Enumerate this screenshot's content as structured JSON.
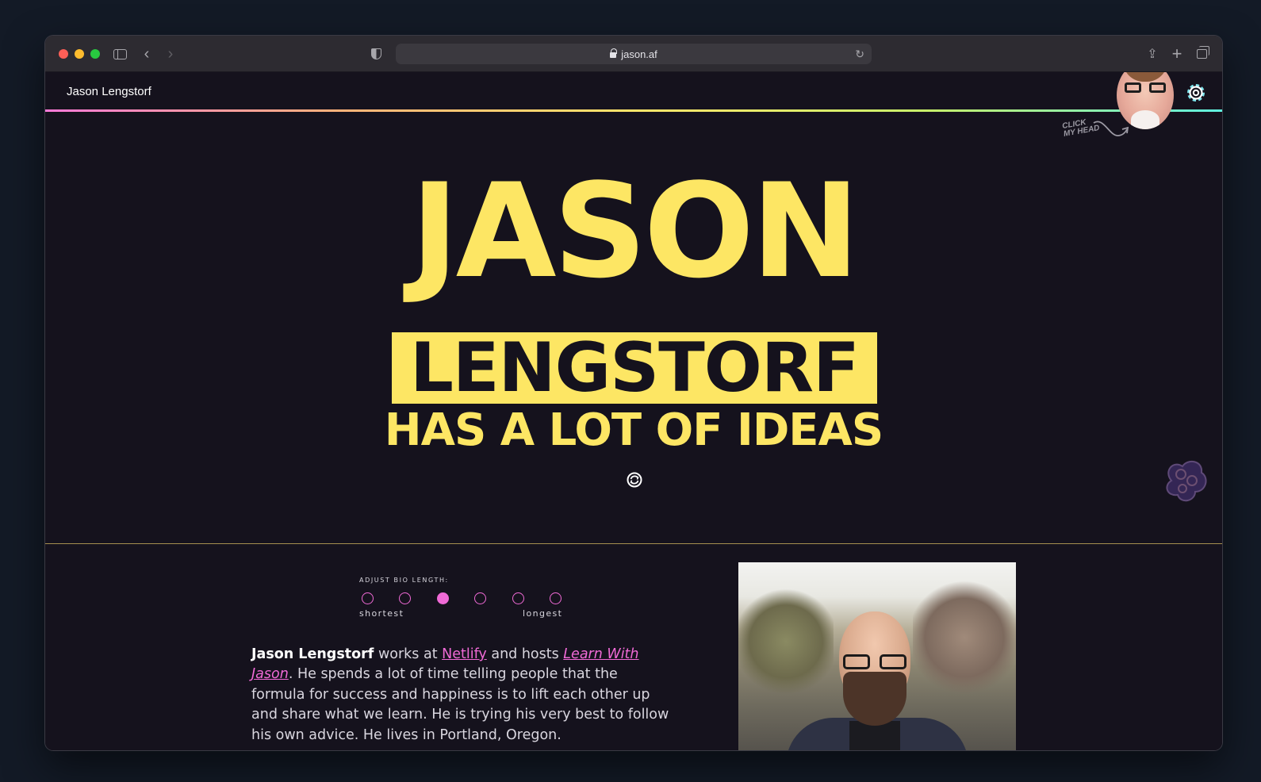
{
  "browser": {
    "url": "jason.af"
  },
  "site": {
    "name": "Jason Lengstorf",
    "click_note_line1": "CLICK",
    "click_note_line2": "MY HEAD"
  },
  "hero": {
    "first_name": "JASON",
    "last_name": "LENGSTORF",
    "tagline": "HAS A LOT OF IDEAS",
    "accent_color": "#fde664"
  },
  "bio_control": {
    "label": "ADJUST BIO LENGTH:",
    "options": 6,
    "selected_index": 2,
    "min_label": "shortest",
    "max_label": "longest",
    "accent_color": "#f06ad6"
  },
  "bio": {
    "name": "Jason Lengstorf",
    "works_at": " works at ",
    "employer": "Netlify",
    "and_hosts": " and hosts ",
    "show": "Learn With Jason",
    "period": ".",
    "rest": " He spends a lot of time telling people that the formula for success and happiness is to lift each other up and share what we learn. He is trying his very best to follow his own advice. He lives in Portland, Oregon."
  }
}
